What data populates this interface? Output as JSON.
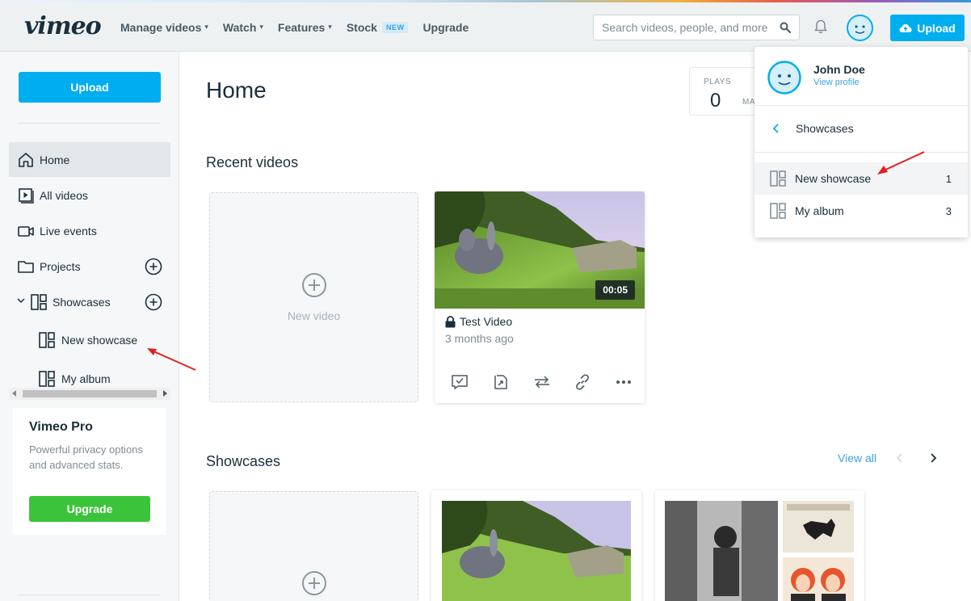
{
  "header": {
    "logo": "vimeo",
    "nav": [
      {
        "label": "Manage videos",
        "has_menu": true
      },
      {
        "label": "Watch",
        "has_menu": true
      },
      {
        "label": "Features",
        "has_menu": true
      },
      {
        "label": "Stock",
        "badge": "NEW"
      },
      {
        "label": "Upgrade"
      }
    ],
    "search_placeholder": "Search videos, people, and more",
    "upload_label": "Upload"
  },
  "sidebar": {
    "upload_label": "Upload",
    "items": [
      {
        "label": "Home",
        "icon": "home-icon",
        "active": true
      },
      {
        "label": "All videos",
        "icon": "video-icon"
      },
      {
        "label": "Live events",
        "icon": "camera-icon"
      },
      {
        "label": "Projects",
        "icon": "folder-icon"
      },
      {
        "label": "Showcases",
        "icon": "showcase-icon"
      }
    ],
    "sub_items": [
      {
        "label": "New showcase",
        "icon": "showcase-icon"
      },
      {
        "label": "My album",
        "icon": "showcase-icon"
      }
    ],
    "pro": {
      "title": "Vimeo Pro",
      "description": "Powerful privacy options and advanced stats.",
      "button": "Upgrade"
    }
  },
  "main": {
    "title": "Home",
    "stats": {
      "label": "PLAYS",
      "value": "0",
      "second_label": "MA"
    },
    "recent_videos": {
      "title": "Recent videos",
      "new_video_label": "New video",
      "videos": [
        {
          "title": "Test Video",
          "meta": "3 months ago",
          "duration": "00:05",
          "private": true
        }
      ]
    },
    "showcases": {
      "title": "Showcases",
      "view_all": "View all"
    }
  },
  "dropdown": {
    "name": "John Doe",
    "view_profile": "View profile",
    "back_label": "Showcases",
    "items": [
      {
        "label": "New showcase",
        "count": "1",
        "highlighted": true
      },
      {
        "label": "My album",
        "count": "3"
      }
    ]
  },
  "colors": {
    "accent": "#00adef",
    "upgrade_green": "#3bc43b",
    "link_blue": "#3aa3e3",
    "annotation_red": "#e02020"
  }
}
